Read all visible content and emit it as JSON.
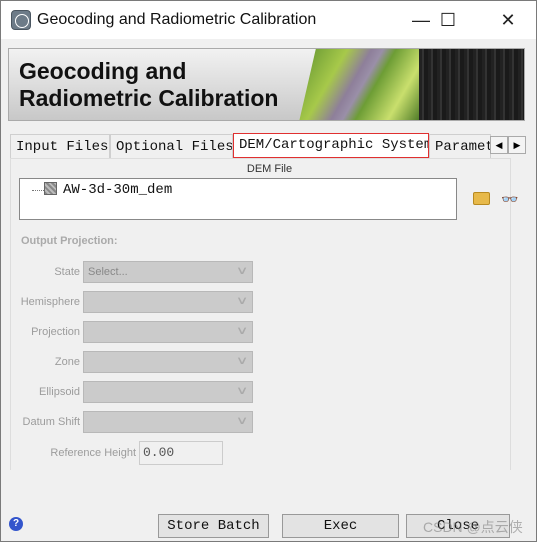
{
  "window": {
    "title": "Geocoding and Radiometric Calibration",
    "minimize": "—",
    "maximize": "☐",
    "close": "✕"
  },
  "banner": {
    "title": "Geocoding and Radiometric Calibration"
  },
  "tabs": [
    {
      "label": "Input Files",
      "active": false
    },
    {
      "label": "Optional Files",
      "active": false
    },
    {
      "label": "DEM/Cartographic System",
      "active": true
    },
    {
      "label": "Parameters",
      "active": false
    }
  ],
  "tab_scroll": {
    "left": "◀",
    "right": "▶"
  },
  "dem": {
    "label": "DEM File",
    "files": [
      "AW-3d-30m_dem"
    ],
    "open_icon": "folder-open-icon",
    "find_icon": "binoculars-icon",
    "find_glyph": "👓"
  },
  "output_projection": {
    "heading": "Output Projection:",
    "fields": [
      {
        "label": "State",
        "value": "Select..."
      },
      {
        "label": "Hemisphere",
        "value": ""
      },
      {
        "label": "Projection",
        "value": ""
      },
      {
        "label": "Zone",
        "value": ""
      },
      {
        "label": "Ellipsoid",
        "value": ""
      },
      {
        "label": "Datum Shift",
        "value": ""
      }
    ],
    "chevron": "∨",
    "reference_height": {
      "label": "Reference Height",
      "value": "0.00"
    }
  },
  "footer": {
    "help": "?",
    "store_batch": "Store Batch",
    "exec": "Exec",
    "close": "Close",
    "watermark": "CSDN @点云侠"
  }
}
